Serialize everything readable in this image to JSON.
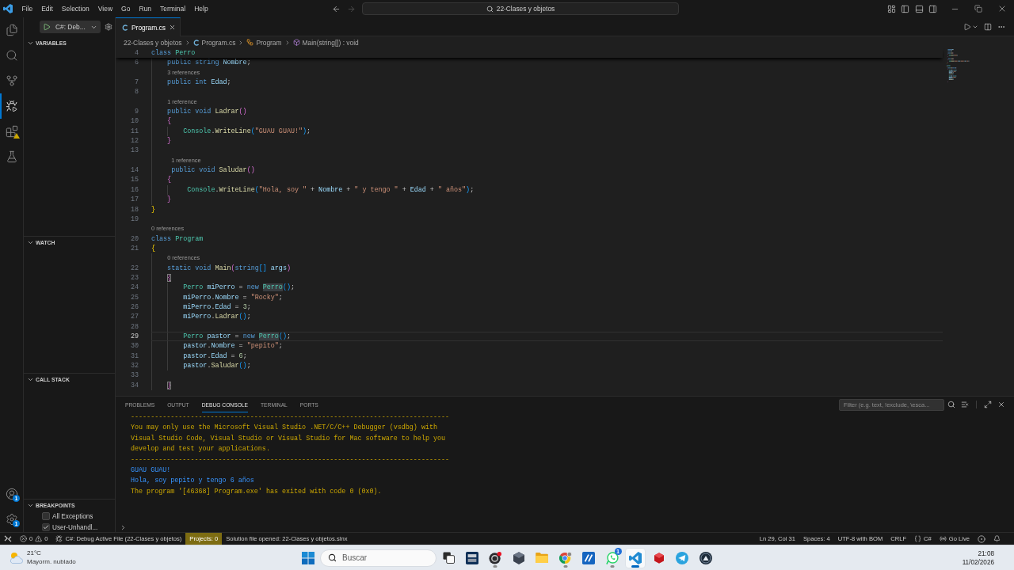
{
  "title_bar": {
    "menu": [
      "File",
      "Edit",
      "Selection",
      "View",
      "Go",
      "Run",
      "Terminal",
      "Help"
    ],
    "navigation": [
      {
        "kind": "back",
        "disabled": false
      },
      {
        "kind": "forward",
        "disabled": true
      }
    ],
    "search": {
      "value": "22-Clases y objetos"
    }
  },
  "activity_bar": {
    "top": [
      {
        "kind": "explorer",
        "selected": false,
        "warning": false
      },
      {
        "kind": "search",
        "selected": false,
        "warning": false
      },
      {
        "kind": "scm",
        "selected": false,
        "warning": false
      },
      {
        "kind": "debug",
        "selected": true,
        "warning": false
      },
      {
        "kind": "extensions",
        "selected": false,
        "warning": true
      },
      {
        "kind": "testing",
        "selected": false,
        "warning": false
      }
    ],
    "bottom": [
      {
        "kind": "account",
        "badge": "1"
      },
      {
        "kind": "settings",
        "badge": "1"
      }
    ]
  },
  "sidebar": {
    "launch": {
      "configuration": "C#: Deb..."
    },
    "sections": [
      {
        "title": "VARIABLES",
        "expanded": true
      },
      {
        "title": "WATCH",
        "expanded": true
      },
      {
        "title": "CALL STACK",
        "expanded": true
      },
      {
        "title": "BREAKPOINTS",
        "expanded": true,
        "items": [
          {
            "label": "All Exceptions",
            "checked": false
          },
          {
            "label": "User-Unhandl...",
            "checked": true
          }
        ]
      }
    ]
  },
  "editor": {
    "tabs": [
      {
        "label": "Program.cs",
        "selected": true
      }
    ],
    "breadcrumbs": [
      {
        "kind": "folder",
        "label": "22-Clases y objetos"
      },
      {
        "kind": "file",
        "label": "Program.cs"
      },
      {
        "kind": "class",
        "label": "Program"
      },
      {
        "kind": "method",
        "label": "Main(string[]) : void"
      }
    ],
    "sticky": {
      "number": "4",
      "tokens": [
        {
          "text": "class ",
          "kind": "keyword"
        },
        {
          "text": "Perro",
          "kind": "type"
        }
      ]
    },
    "lines": [
      {
        "number": "6",
        "current": false,
        "tokens": [
          {
            "text": "    public string ",
            "kind": "keyword"
          },
          {
            "text": "Nombre",
            "kind": "variable"
          },
          {
            "text": ";",
            "kind": "punct"
          }
        ]
      },
      {
        "number": "7",
        "current": false,
        "lens": "3 references",
        "tokens": [
          {
            "text": "    public int ",
            "kind": "keyword"
          },
          {
            "text": "Edad",
            "kind": "variable"
          },
          {
            "text": ";",
            "kind": "punct"
          }
        ]
      },
      {
        "number": "8",
        "current": false
      },
      {
        "number": "9",
        "current": false,
        "lens": "1 reference",
        "tokens": [
          {
            "text": "    public void ",
            "kind": "keyword"
          },
          {
            "text": "Ladrar",
            "kind": "method"
          },
          {
            "text": "()",
            "kind": "bracket2"
          }
        ]
      },
      {
        "number": "10",
        "current": false,
        "tokens": [
          {
            "text": "    {",
            "kind": "bracket2"
          }
        ]
      },
      {
        "number": "11",
        "current": false,
        "tokens": [
          {
            "text": "        Console",
            "kind": "type"
          },
          {
            "text": ".",
            "kind": "punct"
          },
          {
            "text": "WriteLine",
            "kind": "method"
          },
          {
            "text": "(",
            "kind": "bracket3"
          },
          {
            "text": "\"GUAU GUAU!\"",
            "kind": "string"
          },
          {
            "text": ")",
            "kind": "bracket3"
          },
          {
            "text": ";",
            "kind": "punct"
          }
        ]
      },
      {
        "number": "12",
        "current": false,
        "tokens": [
          {
            "text": "    }",
            "kind": "bracket2"
          }
        ]
      },
      {
        "number": "13",
        "current": false
      },
      {
        "number": "14",
        "current": false,
        "lens": "1 reference",
        "tokens": [
          {
            "text": "     public void ",
            "kind": "keyword"
          },
          {
            "text": "Saludar",
            "kind": "method"
          },
          {
            "text": "()",
            "kind": "bracket2"
          }
        ]
      },
      {
        "number": "15",
        "current": false,
        "tokens": [
          {
            "text": "    {",
            "kind": "bracket2"
          }
        ]
      },
      {
        "number": "16",
        "current": false,
        "tokens": [
          {
            "text": "         Console",
            "kind": "type"
          },
          {
            "text": ".",
            "kind": "punct"
          },
          {
            "text": "WriteLine",
            "kind": "method"
          },
          {
            "text": "(",
            "kind": "bracket3"
          },
          {
            "text": "\"Hola, soy \"",
            "kind": "string"
          },
          {
            "text": " + ",
            "kind": "punct"
          },
          {
            "text": "Nombre",
            "kind": "variable"
          },
          {
            "text": " + ",
            "kind": "punct"
          },
          {
            "text": "\" y tengo \"",
            "kind": "string"
          },
          {
            "text": " + ",
            "kind": "punct"
          },
          {
            "text": "Edad",
            "kind": "variable"
          },
          {
            "text": " + ",
            "kind": "punct"
          },
          {
            "text": "\" años\"",
            "kind": "string"
          },
          {
            "text": ")",
            "kind": "bracket3"
          },
          {
            "text": ";",
            "kind": "punct"
          }
        ]
      },
      {
        "number": "17",
        "current": false,
        "tokens": [
          {
            "text": "    }",
            "kind": "bracket2"
          }
        ]
      },
      {
        "number": "18",
        "current": false,
        "tokens": [
          {
            "text": "}",
            "kind": "bracket1"
          }
        ]
      },
      {
        "number": "19",
        "current": false
      },
      {
        "number": "20",
        "current": false,
        "lens": "0 references",
        "tokens": [
          {
            "text": "class ",
            "kind": "keyword"
          },
          {
            "text": "Program",
            "kind": "type"
          }
        ]
      },
      {
        "number": "21",
        "current": false,
        "tokens": [
          {
            "text": "{",
            "kind": "bracket1"
          }
        ]
      },
      {
        "number": "22",
        "current": false,
        "lens": "0 references",
        "tokens": [
          {
            "text": "    static void ",
            "kind": "keyword"
          },
          {
            "text": "Main",
            "kind": "method"
          },
          {
            "text": "(",
            "kind": "bracket2"
          },
          {
            "text": "string",
            "kind": "keyword"
          },
          {
            "text": "[]",
            "kind": "bracket3"
          },
          {
            "text": " args",
            "kind": "variable"
          },
          {
            "text": ")",
            "kind": "bracket2"
          }
        ]
      },
      {
        "number": "23",
        "current": false,
        "tokens": [
          {
            "text": "    {",
            "kind": "matched"
          }
        ]
      },
      {
        "number": "24",
        "current": false,
        "tokens": [
          {
            "text": "        Perro",
            "kind": "type"
          },
          {
            "text": " miPerro",
            "kind": "variable"
          },
          {
            "text": " = ",
            "kind": "punct"
          },
          {
            "text": "new ",
            "kind": "keyword"
          },
          {
            "text": "Perro",
            "kind": "reference"
          },
          {
            "text": "()",
            "kind": "bracket3"
          },
          {
            "text": ";",
            "kind": "punct"
          }
        ]
      },
      {
        "number": "25",
        "current": false,
        "tokens": [
          {
            "text": "        miPerro",
            "kind": "variable"
          },
          {
            "text": ".",
            "kind": "punct"
          },
          {
            "text": "Nombre",
            "kind": "variable"
          },
          {
            "text": " = ",
            "kind": "punct"
          },
          {
            "text": "\"Rocky\"",
            "kind": "string"
          },
          {
            "text": ";",
            "kind": "punct"
          }
        ]
      },
      {
        "number": "26",
        "current": false,
        "tokens": [
          {
            "text": "        miPerro",
            "kind": "variable"
          },
          {
            "text": ".",
            "kind": "punct"
          },
          {
            "text": "Edad",
            "kind": "variable"
          },
          {
            "text": " = ",
            "kind": "punct"
          },
          {
            "text": "3",
            "kind": "number"
          },
          {
            "text": ";",
            "kind": "punct"
          }
        ]
      },
      {
        "number": "27",
        "current": false,
        "tokens": [
          {
            "text": "        miPerro",
            "kind": "variable"
          },
          {
            "text": ".",
            "kind": "punct"
          },
          {
            "text": "Ladrar",
            "kind": "method"
          },
          {
            "text": "()",
            "kind": "bracket3"
          },
          {
            "text": ";",
            "kind": "punct"
          }
        ]
      },
      {
        "number": "28",
        "current": false
      },
      {
        "number": "29",
        "current": true,
        "tokens": [
          {
            "text": "        Perro",
            "kind": "type"
          },
          {
            "text": " pastor",
            "kind": "variable"
          },
          {
            "text": " = ",
            "kind": "punct"
          },
          {
            "text": "new ",
            "kind": "keyword"
          },
          {
            "text": "Perro",
            "kind": "reference"
          },
          {
            "text": "()",
            "kind": "bracket3"
          },
          {
            "text": ";",
            "kind": "punct"
          }
        ]
      },
      {
        "number": "30",
        "current": false,
        "tokens": [
          {
            "text": "        pastor",
            "kind": "variable"
          },
          {
            "text": ".",
            "kind": "punct"
          },
          {
            "text": "Nombre",
            "kind": "variable"
          },
          {
            "text": " = ",
            "kind": "punct"
          },
          {
            "text": "\"pepito\"",
            "kind": "string"
          },
          {
            "text": ";",
            "kind": "punct"
          }
        ]
      },
      {
        "number": "31",
        "current": false,
        "tokens": [
          {
            "text": "        pastor",
            "kind": "variable"
          },
          {
            "text": ".",
            "kind": "punct"
          },
          {
            "text": "Edad",
            "kind": "variable"
          },
          {
            "text": " = ",
            "kind": "punct"
          },
          {
            "text": "6",
            "kind": "number"
          },
          {
            "text": ";",
            "kind": "punct"
          }
        ]
      },
      {
        "number": "32",
        "current": false,
        "tokens": [
          {
            "text": "        pastor",
            "kind": "variable"
          },
          {
            "text": ".",
            "kind": "punct"
          },
          {
            "text": "Saludar",
            "kind": "method"
          },
          {
            "text": "()",
            "kind": "bracket3"
          },
          {
            "text": ";",
            "kind": "punct"
          }
        ]
      },
      {
        "number": "33",
        "current": false
      },
      {
        "number": "34",
        "current": false,
        "tokens": [
          {
            "text": "    }",
            "kind": "matched"
          }
        ]
      }
    ]
  },
  "panel": {
    "tabs": [
      {
        "label": "PROBLEMS",
        "selected": false
      },
      {
        "label": "OUTPUT",
        "selected": false
      },
      {
        "label": "DEBUG CONSOLE",
        "selected": true
      },
      {
        "label": "TERMINAL",
        "selected": false
      },
      {
        "label": "PORTS",
        "selected": false
      }
    ],
    "filter": {
      "placeholder": "Filter (e.g. text, !exclude, \\esca..."
    },
    "console": [
      {
        "kind": "warning",
        "text": "--------------------------------------------------------------------------------"
      },
      {
        "kind": "warning",
        "text": "You may only use the Microsoft Visual Studio .NET/C/C++ Debugger (vsdbg) with"
      },
      {
        "kind": "warning",
        "text": "Visual Studio Code, Visual Studio or Visual Studio for Mac software to help you"
      },
      {
        "kind": "warning",
        "text": "develop and test your applications."
      },
      {
        "kind": "warning",
        "text": "--------------------------------------------------------------------------------"
      },
      {
        "kind": "output",
        "text": "GUAU GUAU!"
      },
      {
        "kind": "output",
        "text": "Hola, soy pepito y tengo 6 años"
      },
      {
        "kind": "warning",
        "text": "The program '[46368] Program.exe' has exited with code 0 (0x0)."
      }
    ]
  },
  "status_bar": {
    "errors": "0",
    "warnings": "0",
    "launch": "C#: Debug Active File (22-Clases y objetos)",
    "projects": "Projects: 0",
    "message": "Solution file opened: 22-Clases y objetos.slnx",
    "cursor": "Ln 29, Col 31",
    "indentation": "Spaces: 4",
    "encoding": "UTF-8 with BOM",
    "line_ending": "CRLF",
    "language": "C#",
    "live_server": "Go Live"
  },
  "taskbar": {
    "weather": {
      "temperature": "21°C",
      "condition": "Mayorm. nublado"
    },
    "search": {
      "placeholder": "Buscar"
    },
    "apps": [
      {
        "kind": "taskview",
        "running": false,
        "selected": false
      },
      {
        "kind": "tia",
        "running": false,
        "selected": false
      },
      {
        "kind": "recorder",
        "running": true,
        "selected": false
      },
      {
        "kind": "cube",
        "running": false,
        "selected": false
      },
      {
        "kind": "folder",
        "running": false,
        "selected": false
      },
      {
        "kind": "browser",
        "running": true,
        "selected": false
      },
      {
        "kind": "editor",
        "running": false,
        "selected": false
      },
      {
        "kind": "chat",
        "running": true,
        "selected": false,
        "badge": "1"
      },
      {
        "kind": "code",
        "running": true,
        "selected": true
      },
      {
        "kind": "redcube",
        "running": false,
        "selected": false
      },
      {
        "kind": "messenger",
        "running": false,
        "selected": false
      },
      {
        "kind": "darkapp",
        "running": false,
        "selected": false
      }
    ],
    "clock": {
      "time": "21:08",
      "date": "11/02/2026"
    }
  }
}
